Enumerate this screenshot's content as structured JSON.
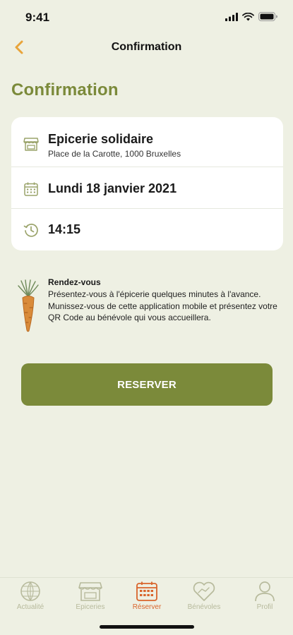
{
  "status_bar": {
    "time": "9:41"
  },
  "nav": {
    "title": "Confirmation",
    "back_icon": "chevron-left-icon"
  },
  "page": {
    "title": "Confirmation"
  },
  "booking": {
    "store_name": "Epicerie solidaire",
    "store_address": "Place de la Carotte, 1000 Bruxelles",
    "date": "Lundi 18 janvier 2021",
    "time": "14:15"
  },
  "info": {
    "title": "Rendez-vous",
    "text": "Présentez-vous à l'épicerie quelques minutes à l'avance. Munissez-vous de cette application mobile et présentez votre QR Code au bénévole qui vous accueillera."
  },
  "reserve_button": {
    "label": "RESERVER"
  },
  "tabs": [
    {
      "label": "Actualité",
      "icon": "news-globe-icon",
      "active": false
    },
    {
      "label": "Epiceries",
      "icon": "storefront-icon",
      "active": false
    },
    {
      "label": "Réserver",
      "icon": "calendar-icon",
      "active": true
    },
    {
      "label": "Bénévoles",
      "icon": "heart-hands-icon",
      "active": false
    },
    {
      "label": "Profil",
      "icon": "user-icon",
      "active": false
    }
  ],
  "colors": {
    "background": "#eef0e3",
    "accent": "#7b8a3a",
    "active_tab": "#d9652c",
    "inactive_tab": "#b7ba9c"
  }
}
